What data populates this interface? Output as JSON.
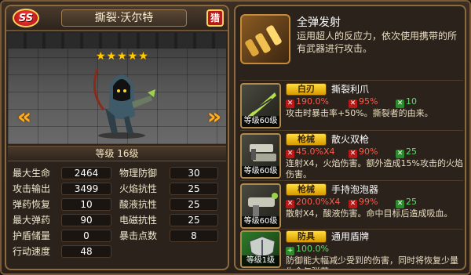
{
  "hero": {
    "rank_badge": "SS",
    "name": "撕裂·沃尔特",
    "class_badge": "猎",
    "stars": "★★★★★",
    "level": "等级 16级",
    "stats": [
      {
        "label": "最大生命",
        "value": "2464"
      },
      {
        "label": "物理防御",
        "value": "30"
      },
      {
        "label": "攻击输出",
        "value": "3499"
      },
      {
        "label": "火焰抗性",
        "value": "25"
      },
      {
        "label": "弹药恢复",
        "value": "10"
      },
      {
        "label": "酸液抗性",
        "value": "25"
      },
      {
        "label": "最大弹药",
        "value": "90"
      },
      {
        "label": "电磁抗性",
        "value": "25"
      },
      {
        "label": "护盾储量",
        "value": "0"
      },
      {
        "label": "暴击点数",
        "value": "8"
      },
      {
        "label": "行动速度",
        "value": "48"
      }
    ]
  },
  "feature": {
    "title": "全弹发射",
    "desc": "运用超人的反应力，依次使用携带的所有武器进行攻击。"
  },
  "weapons": [
    {
      "category": "白刃",
      "name": "撕裂利爪",
      "level": "等级60级",
      "stats": [
        {
          "icon": "red",
          "value": "190.0%",
          "color": "red"
        },
        {
          "icon": "red",
          "value": "95%",
          "color": "red"
        },
        {
          "icon": "green",
          "value": "10",
          "color": "green"
        }
      ],
      "desc": "攻击时暴击率+50%。撕裂者的由来。"
    },
    {
      "category": "枪械",
      "name": "散火双枪",
      "level": "等级60级",
      "stats": [
        {
          "icon": "red",
          "value": "45.0%X4",
          "color": "red"
        },
        {
          "icon": "red",
          "value": "90%",
          "color": "red"
        },
        {
          "icon": "green",
          "value": "25",
          "color": "green"
        }
      ],
      "desc": "连射X4，火焰伤害。额外造成15%攻击的火焰伤害。"
    },
    {
      "category": "枪械",
      "name": "手持泡泡器",
      "level": "等级60级",
      "stats": [
        {
          "icon": "red",
          "value": "200.0%X4",
          "color": "red"
        },
        {
          "icon": "red",
          "value": "99%",
          "color": "red"
        },
        {
          "icon": "green",
          "value": "25",
          "color": "green"
        }
      ],
      "desc": "散射X4，酸液伤害。命中目标后造成吸血。"
    },
    {
      "category": "防具",
      "name": "通用盾牌",
      "level": "等级1级",
      "stats": [
        {
          "icon": "green",
          "value": "100.0%",
          "color": "green"
        }
      ],
      "desc": "防御能大幅减少受到的伤害，同时将恢复少量生命与弹药。"
    }
  ]
}
